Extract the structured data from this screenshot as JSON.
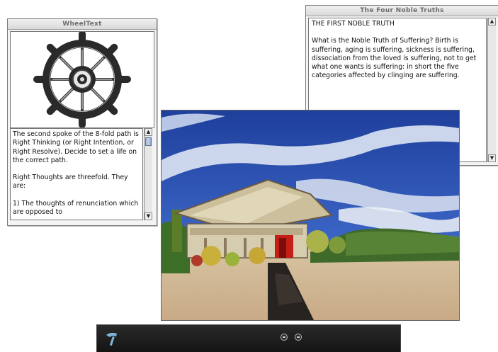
{
  "wheel_window": {
    "title": "WheelText",
    "paragraph1": "The second spoke of the 8-fold path is Right Thinking (or Right Intention, or Right Resolve). Decide to set a life on the correct path.",
    "paragraph2": "Right Thoughts are threefold. They are:",
    "paragraph3": "1) The thoughts of renunciation which are opposed to"
  },
  "truths_window": {
    "title": "The Four Noble Truths",
    "heading": "THE FIRST NOBLE TRUTH",
    "body": "What is the Noble Truth of Suffering? Birth is suffering, aging is suffering, sickness is suffering, dissociation from the loved is suffering, not to get what one wants is suffering: in short the five categories affected by clinging are suffering."
  },
  "icons": {
    "dharma_wheel": "dharma-wheel-icon",
    "scroll_up": "scroll-up-arrow-icon",
    "scroll_down": "scroll-down-arrow-icon",
    "player_logo": "hammer-logo-icon",
    "player_controls": [
      "circle-control-icon",
      "circle-control-icon"
    ]
  },
  "colors": {
    "sky": "#2b4fb0",
    "temple_roof": "#c8b994",
    "temple_door": "#c8201a",
    "player_bar": "#1c1c1c"
  }
}
